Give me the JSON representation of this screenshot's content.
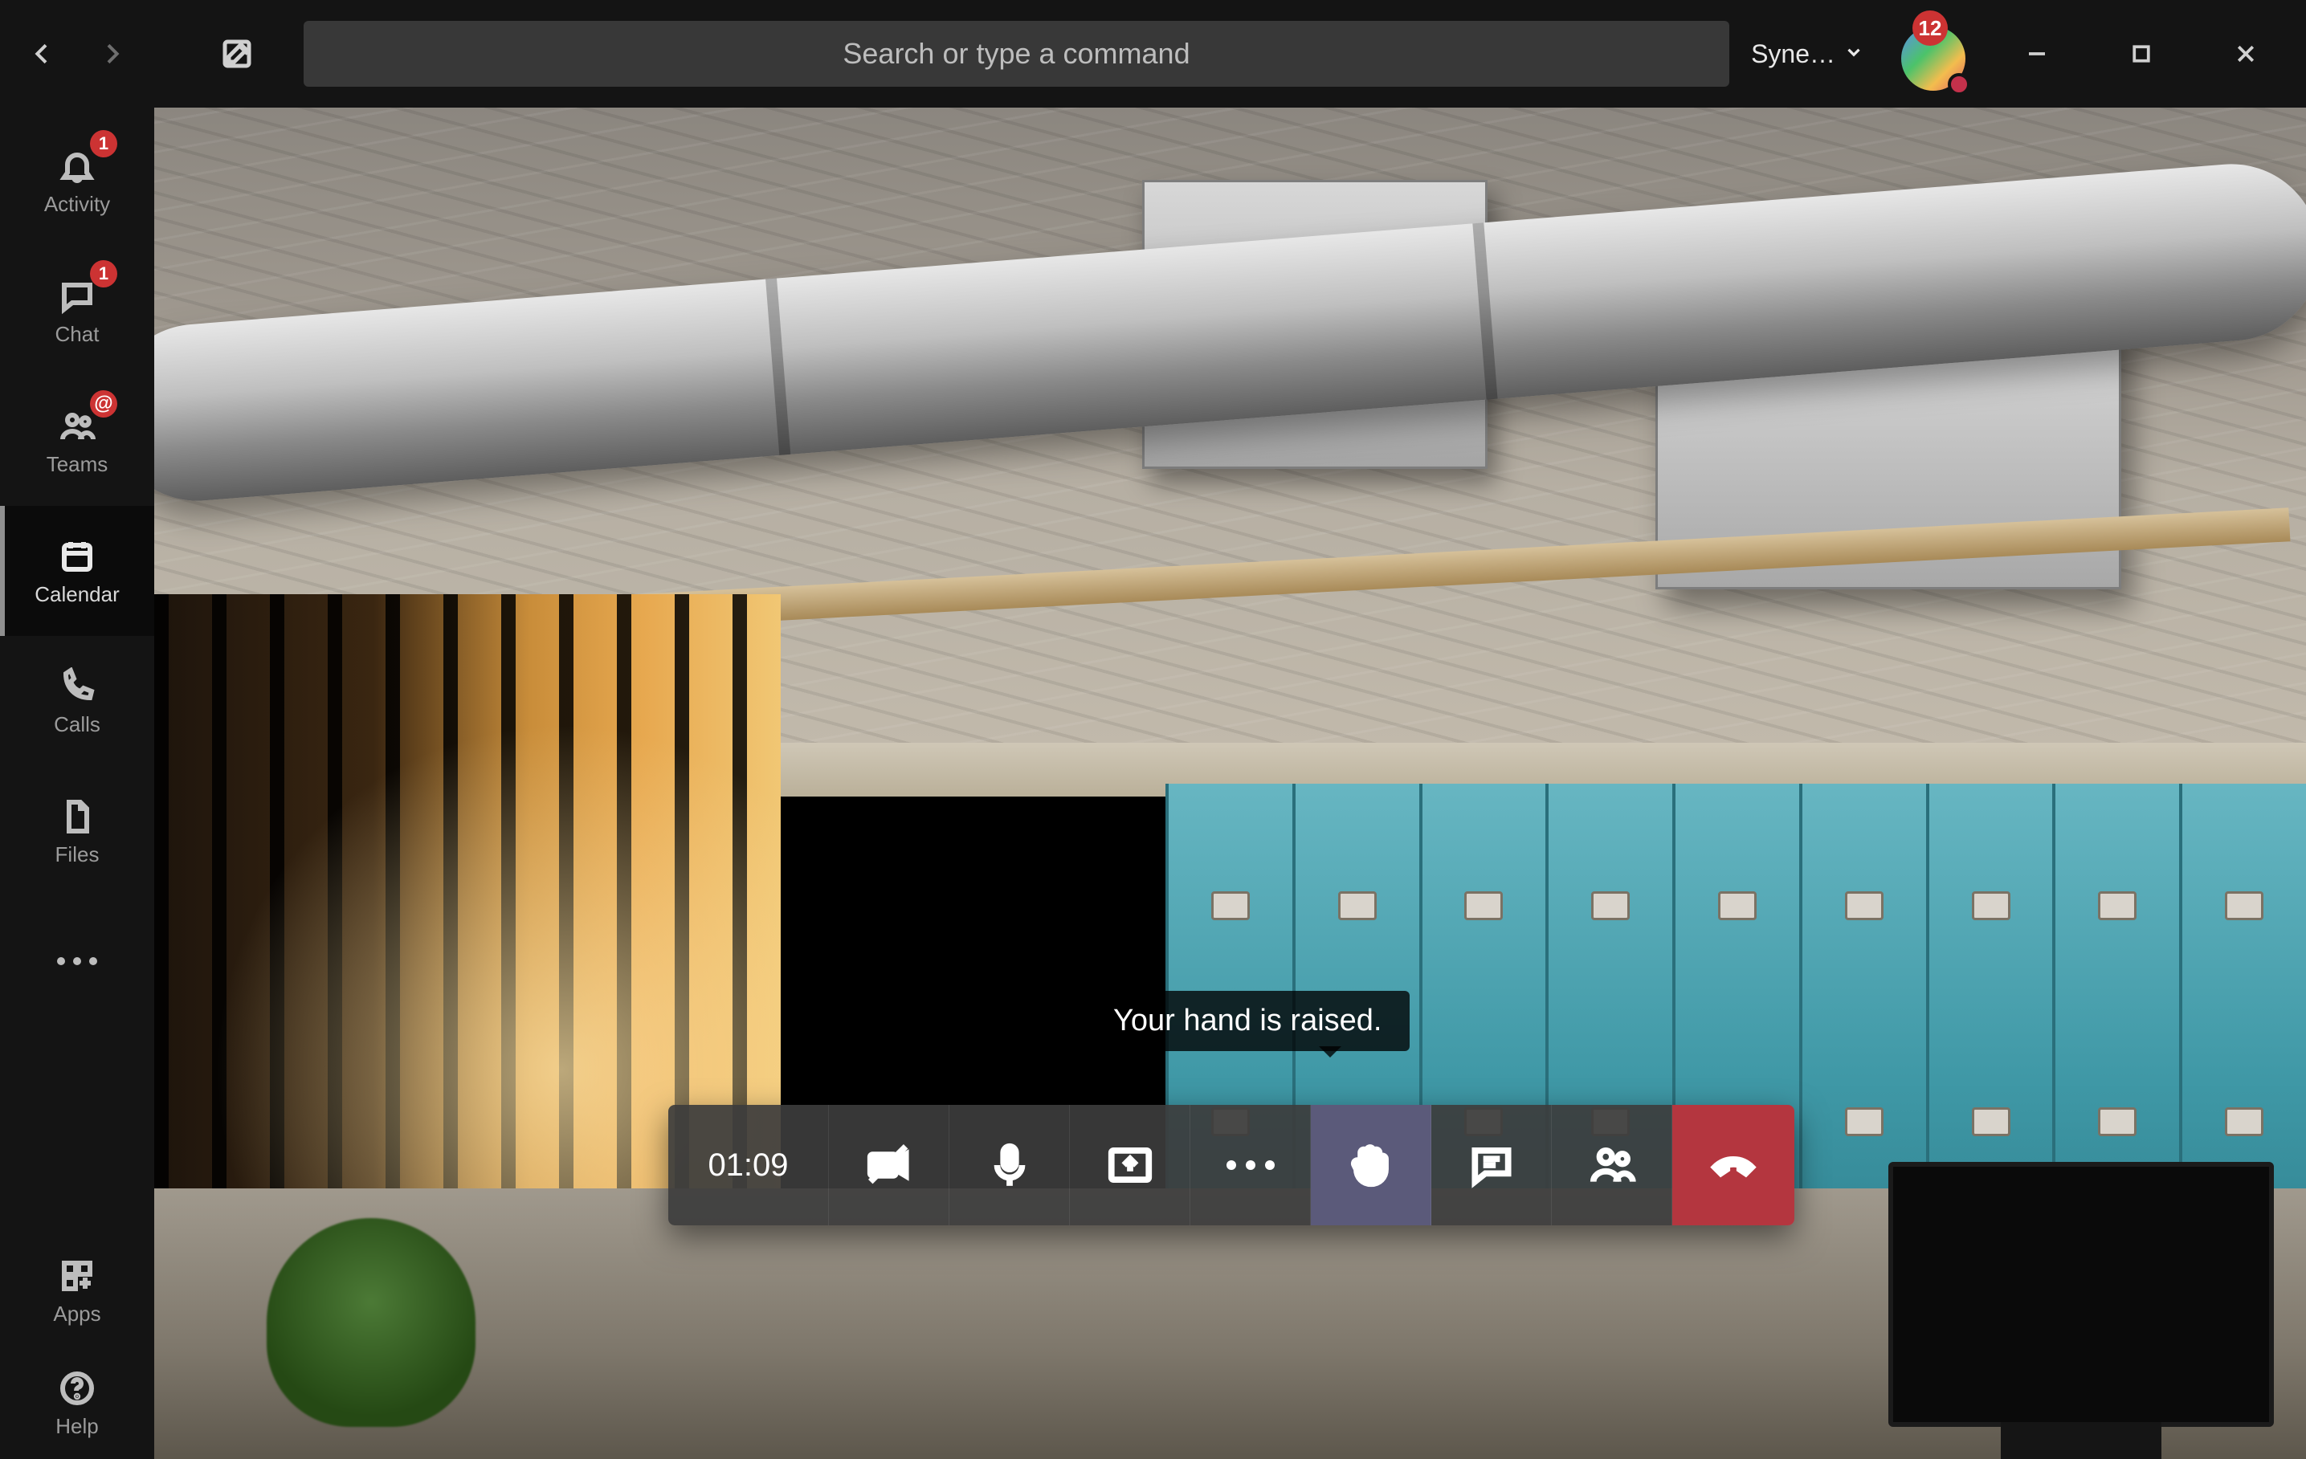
{
  "titlebar": {
    "search_placeholder": "Search or type a command",
    "org_label": "Syne…",
    "notification_count": "12"
  },
  "appbar": {
    "activity": {
      "label": "Activity",
      "badge": "1"
    },
    "chat": {
      "label": "Chat",
      "badge": "1"
    },
    "teams": {
      "label": "Teams",
      "badge": "@"
    },
    "calendar": {
      "label": "Calendar"
    },
    "calls": {
      "label": "Calls"
    },
    "files": {
      "label": "Files"
    },
    "apps": {
      "label": "Apps"
    },
    "help": {
      "label": "Help"
    }
  },
  "call": {
    "timer": "01:09",
    "hand_tooltip": "Your hand is raised."
  }
}
